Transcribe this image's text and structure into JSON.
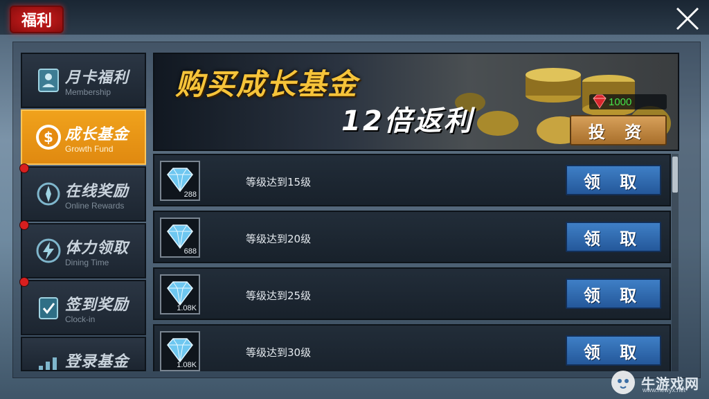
{
  "header": {
    "title": "福利"
  },
  "sidebar": {
    "items": [
      {
        "label": "月卡福利",
        "sub": "Membership",
        "dot": false,
        "active": false,
        "icon": "membership-card-icon"
      },
      {
        "label": "成长基金",
        "sub": "Growth Fund",
        "dot": false,
        "active": true,
        "icon": "dollar-coin-icon"
      },
      {
        "label": "在线奖励",
        "sub": "Online Rewards",
        "dot": true,
        "active": false,
        "icon": "compass-icon"
      },
      {
        "label": "体力领取",
        "sub": "Dining Time",
        "dot": true,
        "active": false,
        "icon": "lightning-icon"
      },
      {
        "label": "签到奖励",
        "sub": "Clock-in",
        "dot": true,
        "active": false,
        "icon": "checkmark-clipboard-icon"
      },
      {
        "label": "登录基金",
        "sub": "",
        "dot": false,
        "active": false,
        "icon": "chart-icon"
      }
    ]
  },
  "banner": {
    "title": "购买成长基金",
    "subtitle": "12倍返利",
    "price": "1000",
    "invest_label": "投 资"
  },
  "rewards": [
    {
      "qty": "288",
      "text": "等级达到15级",
      "button": "领 取"
    },
    {
      "qty": "688",
      "text": "等级达到20级",
      "button": "领 取"
    },
    {
      "qty": "1.08K",
      "text": "等级达到25级",
      "button": "领 取"
    },
    {
      "qty": "1.08K",
      "text": "等级达到30级",
      "button": "领 取"
    }
  ],
  "watermark": {
    "text": "牛游戏网",
    "sub": "www.newyx.net"
  },
  "colors": {
    "accent_orange": "#f0a21c",
    "claim_blue": "#3f7fc6",
    "title_red": "#d21f1f",
    "price_green": "#44e34a"
  }
}
